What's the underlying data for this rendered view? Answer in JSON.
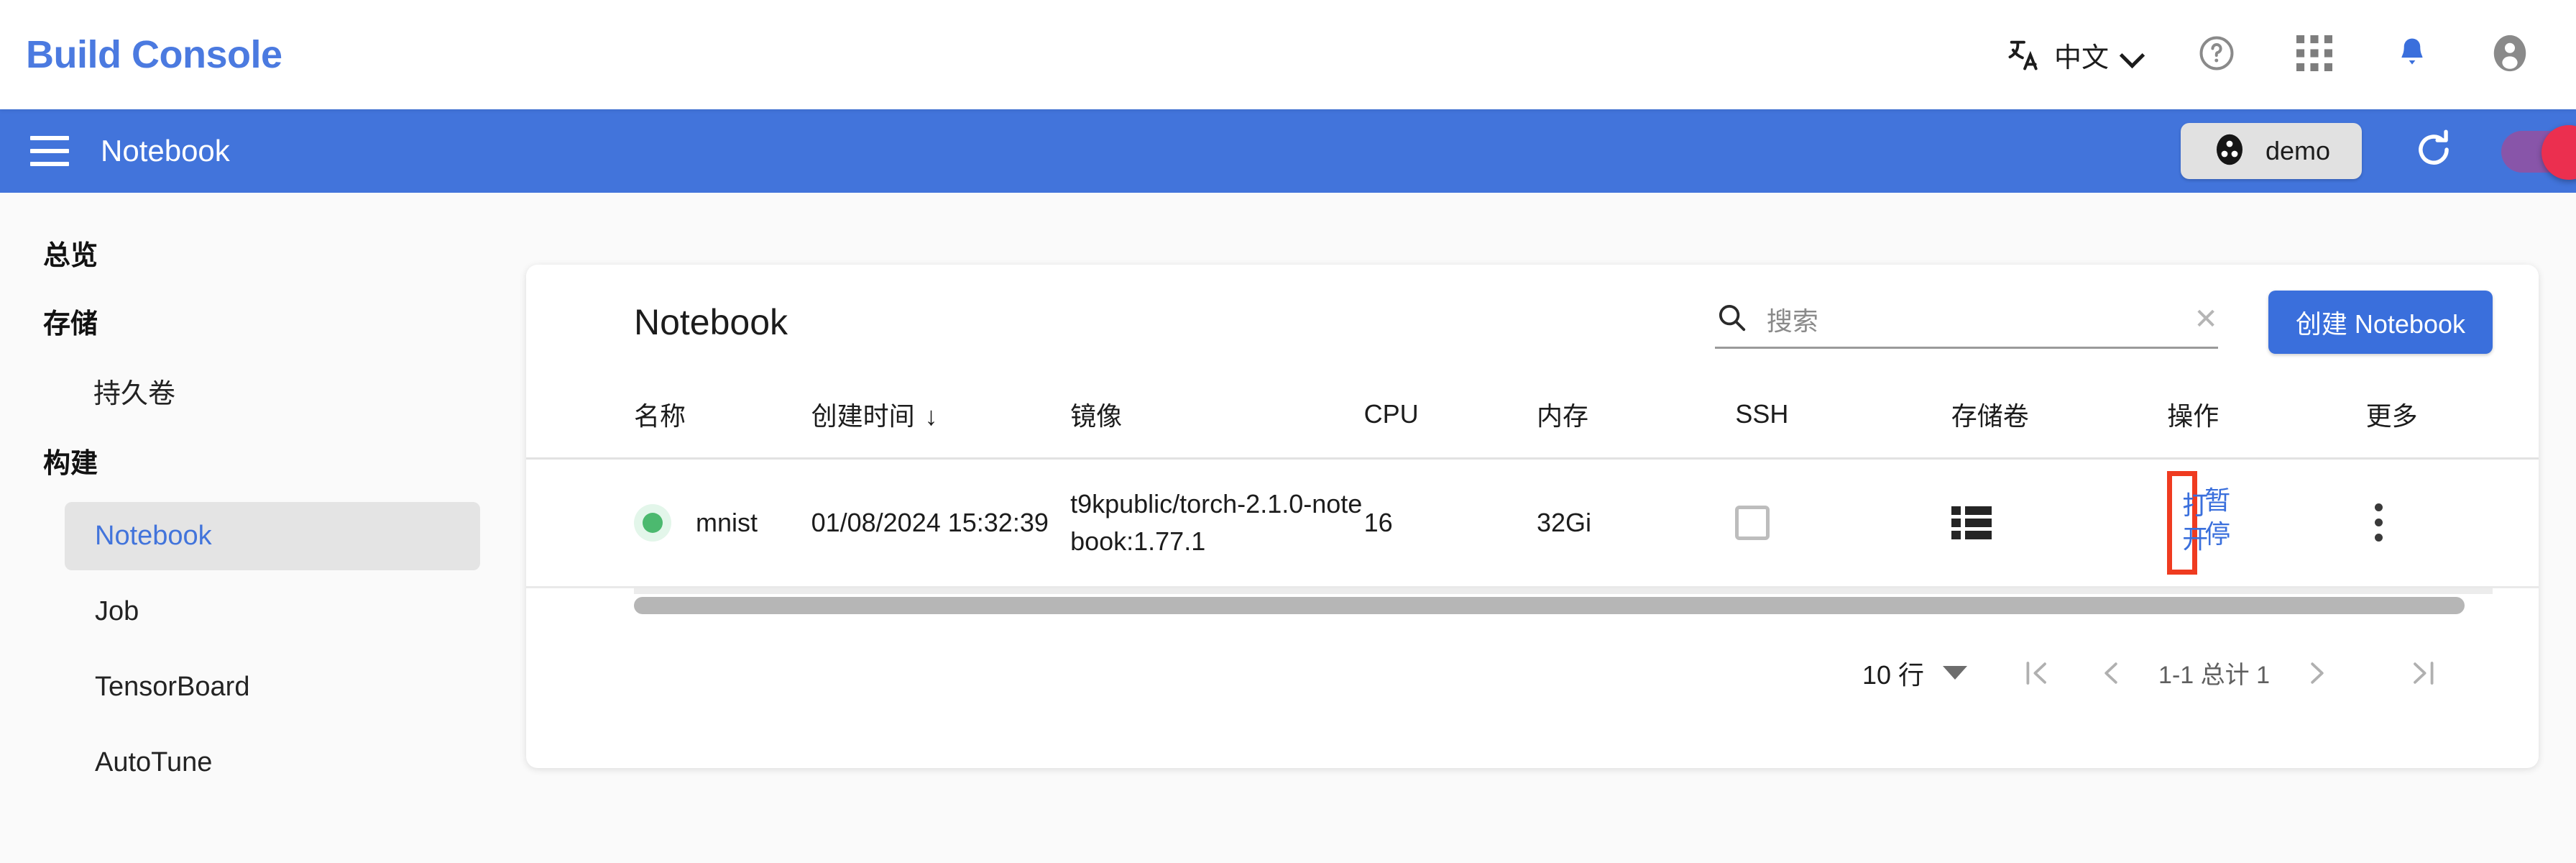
{
  "topbar": {
    "brand": "Build Console",
    "lang_label": "中文",
    "lang_icon": "translate-icon",
    "chevron_icon": "chevron-down-icon",
    "help_icon": "help-circle-icon",
    "apps_icon": "apps-grid-icon",
    "notifications_icon": "bell-icon",
    "account_icon": "account-circle-icon",
    "accent_color": "#4b7ae0"
  },
  "appbar": {
    "menu_icon": "hamburger-menu-icon",
    "title": "Notebook",
    "project_label": "demo",
    "project_icon": "project-dots-icon",
    "refresh_icon": "refresh-icon",
    "toggle_icon": "theme-toggle",
    "bg_color": "#4274db"
  },
  "sidebar": {
    "items": [
      {
        "label": "总览",
        "type": "group"
      },
      {
        "label": "存储",
        "type": "group"
      },
      {
        "label": "持久卷",
        "type": "sub"
      },
      {
        "label": "构建",
        "type": "group"
      },
      {
        "label": "Notebook",
        "type": "item",
        "active": true
      },
      {
        "label": "Job",
        "type": "item",
        "active": false
      },
      {
        "label": "TensorBoard",
        "type": "item",
        "active": false
      },
      {
        "label": "AutoTune",
        "type": "item",
        "active": false
      }
    ]
  },
  "card": {
    "title": "Notebook",
    "search": {
      "placeholder": "搜索",
      "value": "",
      "icon": "search-icon",
      "clear": "✕"
    },
    "create_button": "创建 Notebook",
    "create_color": "#3a6fdc"
  },
  "table": {
    "columns": [
      "名称",
      "创建时间",
      "镜像",
      "CPU",
      "内存",
      "SSH",
      "存储卷",
      "操作",
      "更多"
    ],
    "sort_column": "创建时间",
    "sort_arrow": "↓",
    "rows": [
      {
        "status": "running",
        "status_color": "#4cb96f",
        "name": "mnist",
        "created": "01/08/2024 15:32:39",
        "image": "t9kpublic/torch-2.1.0-notebook:1.77.1",
        "cpu": "16",
        "memory": "32Gi",
        "ssh_checked": false,
        "volume_icon": "view-list-icon",
        "action_open": "打开",
        "action_pause": "暂停",
        "more_icon": "kebab-menu-icon"
      }
    ]
  },
  "pagination": {
    "rows_per_page": "10 行",
    "first_icon": "|<",
    "prev_icon": "<",
    "range": "1-1 总计 1",
    "next_icon": ">",
    "last_icon": ">|"
  },
  "annotation": {
    "highlight_target": "打开",
    "highlight_color": "#ef3b20"
  }
}
